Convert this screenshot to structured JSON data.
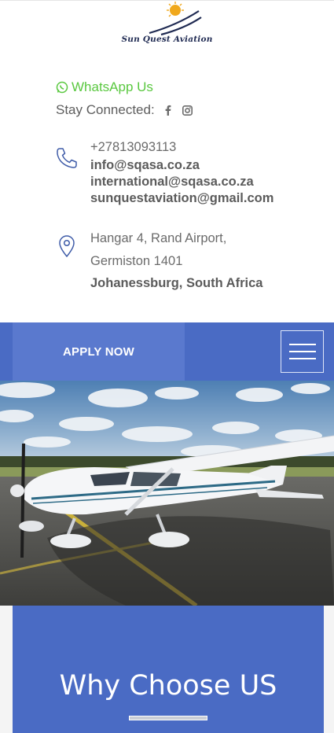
{
  "header": {
    "logo_text": "Sun Quest Aviation"
  },
  "contact": {
    "whatsapp_label": "WhatsApp Us",
    "stay_connected_label": "Stay Connected:",
    "social_icons": [
      "facebook-icon",
      "instagram-icon"
    ],
    "phone": "+27813093113",
    "emails": [
      "info@sqasa.co.za",
      "international@sqasa.co.za",
      "sunquestaviation@gmail.com"
    ],
    "address_line1": "Hangar 4, Rand Airport,",
    "address_line2": "Germiston 1401",
    "address_line3": "Johanessburg, South Africa"
  },
  "nav": {
    "apply_label": "APPLY NOW",
    "menu_icon": "hamburger-icon"
  },
  "section": {
    "why_title": "Why Choose US"
  },
  "colors": {
    "brand_blue": "#4a6bc4",
    "whatsapp_green": "#5ac840"
  }
}
